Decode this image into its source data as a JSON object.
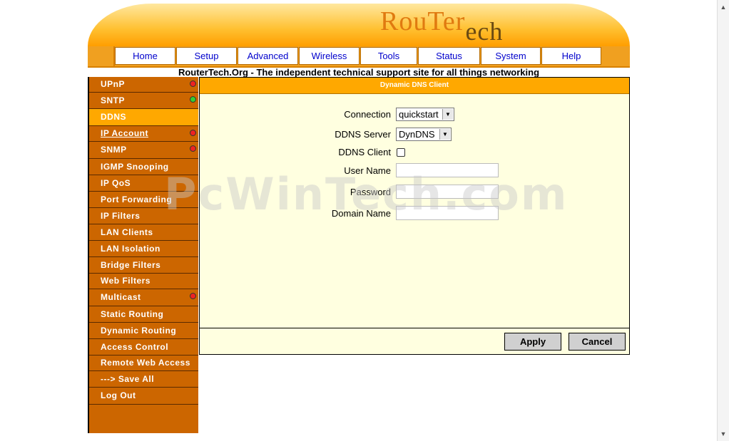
{
  "header": {
    "logo_part1": "Rou",
    "logo_part2": "Ter",
    "logo_part3": "ech",
    "tagline": "RouterTech.Org - The independent technical support site for all things networking"
  },
  "nav": {
    "tabs": [
      {
        "label": "Home"
      },
      {
        "label": "Setup"
      },
      {
        "label": "Advanced"
      },
      {
        "label": "Wireless"
      },
      {
        "label": "Tools"
      },
      {
        "label": "Status"
      },
      {
        "label": "System"
      },
      {
        "label": "Help"
      }
    ]
  },
  "sidebar": {
    "items": [
      {
        "label": "UPnP",
        "status": "red"
      },
      {
        "label": "SNTP",
        "status": "green"
      },
      {
        "label": "DDNS",
        "active": true
      },
      {
        "label": "IP Account",
        "status": "red",
        "underline": true
      },
      {
        "label": "SNMP",
        "status": "red"
      },
      {
        "label": "IGMP Snooping"
      },
      {
        "label": "IP QoS"
      },
      {
        "label": "Port Forwarding"
      },
      {
        "label": "IP Filters"
      },
      {
        "label": "LAN Clients"
      },
      {
        "label": "LAN Isolation"
      },
      {
        "label": "Bridge Filters"
      },
      {
        "label": "Web Filters"
      },
      {
        "label": "Multicast",
        "status": "red"
      },
      {
        "label": "Static Routing"
      },
      {
        "label": "Dynamic Routing"
      },
      {
        "label": "Access Control"
      },
      {
        "label": "Remote Web Access"
      },
      {
        "label": "---> Save All"
      },
      {
        "label": "Log Out"
      }
    ]
  },
  "panel": {
    "title": "Dynamic DNS Client",
    "form": {
      "connection_label": "Connection",
      "connection_value": "quickstart",
      "server_label": "DDNS Server",
      "server_value": "DynDNS",
      "client_label": "DDNS Client",
      "username_label": "User Name",
      "username_value": "",
      "password_label": "Password",
      "password_value": "",
      "domain_label": "Domain Name",
      "domain_value": ""
    },
    "apply_label": "Apply",
    "cancel_label": "Cancel"
  },
  "watermark": "PcWinTech.com",
  "colors": {
    "accent_orange": "#ffa800",
    "sidebar_orange": "#cc6600",
    "panel_bg": "#ffffe0",
    "status_red": "#ee2222",
    "status_green": "#33cc33",
    "nav_link": "#0000cc"
  }
}
